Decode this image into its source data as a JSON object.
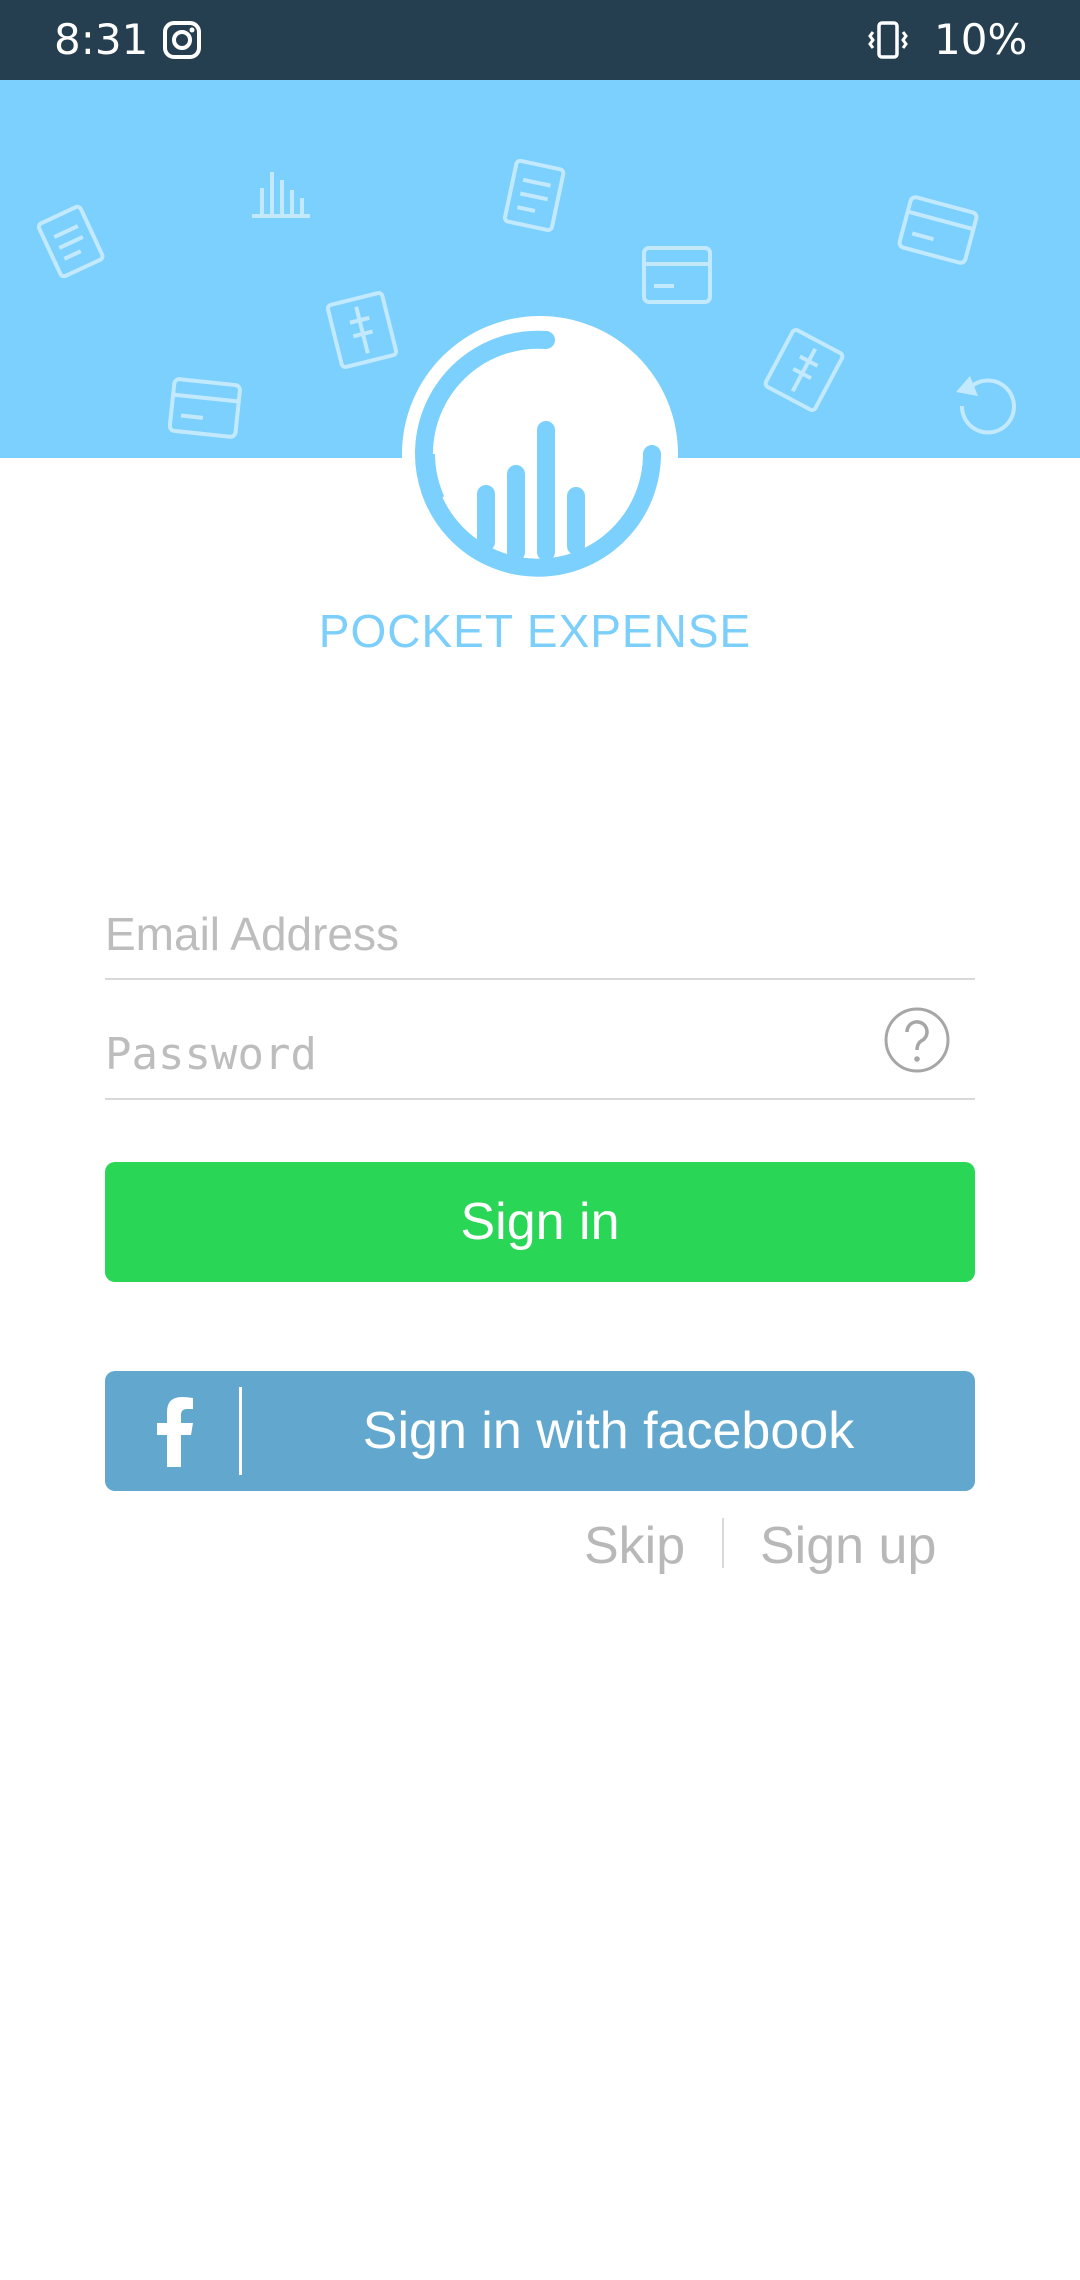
{
  "status_bar": {
    "time": "8:31",
    "battery": "10%",
    "icons": [
      "instagram-icon",
      "vibrate-icon"
    ]
  },
  "app": {
    "title": "POCKET EXPENSE",
    "brand_color": "#7bd0fd",
    "logo_icon": "bar-chart-circle-logo"
  },
  "form": {
    "email_placeholder": "Email Address",
    "password_placeholder": "Password",
    "help_icon": "question-circle-icon"
  },
  "buttons": {
    "sign_in": "Sign in",
    "sign_in_color": "#29d656",
    "facebook": "Sign in with facebook",
    "facebook_color": "#62a7cd"
  },
  "links": {
    "skip": "Skip",
    "sign_up": "Sign up"
  }
}
